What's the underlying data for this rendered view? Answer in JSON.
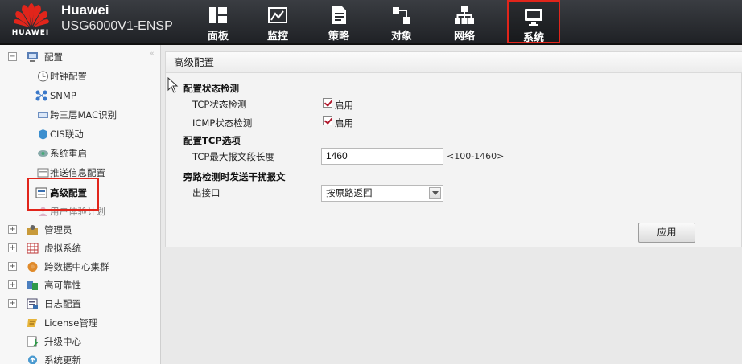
{
  "brand": {
    "logo_text": "HUAWEI",
    "vendor": "Huawei",
    "model": "USG6000V1-ENSP"
  },
  "nav": [
    {
      "label": "面板",
      "icon": "dashboard-icon"
    },
    {
      "label": "监控",
      "icon": "monitor-chart-icon"
    },
    {
      "label": "策略",
      "icon": "policy-document-icon"
    },
    {
      "label": "对象",
      "icon": "object-icon"
    },
    {
      "label": "网络",
      "icon": "network-topology-icon"
    },
    {
      "label": "系统",
      "icon": "system-monitor-icon",
      "active": true
    }
  ],
  "sidebar": {
    "root": {
      "label": "配置",
      "toggle": "−"
    },
    "children": [
      {
        "label": "时钟配置",
        "icon": "clock-icon"
      },
      {
        "label": "SNMP",
        "icon": "snmp-icon"
      },
      {
        "label": "跨三层MAC识别",
        "icon": "mac-icon"
      },
      {
        "label": "CIS联动",
        "icon": "cis-icon"
      },
      {
        "label": "系统重启",
        "icon": "restart-icon"
      },
      {
        "label": "推送信息配置",
        "icon": "push-icon"
      },
      {
        "label": "高级配置",
        "icon": "advanced-config-icon",
        "selected": true
      },
      {
        "label": "用户体验计划",
        "icon": "user-experience-icon"
      }
    ],
    "groups": [
      {
        "label": "管理员",
        "icon": "admin-icon",
        "toggle": "+"
      },
      {
        "label": "虚拟系统",
        "icon": "virtual-system-icon",
        "toggle": "+"
      },
      {
        "label": "跨数据中心集群",
        "icon": "cluster-icon",
        "toggle": "+"
      },
      {
        "label": "高可靠性",
        "icon": "high-availability-icon",
        "toggle": "+"
      },
      {
        "label": "日志配置",
        "icon": "log-config-icon",
        "toggle": "+"
      },
      {
        "label": "License管理",
        "icon": "license-icon"
      },
      {
        "label": "升级中心",
        "icon": "upgrade-icon"
      },
      {
        "label": "系统更新",
        "icon": "update-icon"
      }
    ]
  },
  "panel": {
    "title": "高级配置",
    "section_state": "配置状态检测",
    "tcp_state_label": "TCP状态检测",
    "tcp_state_value": "启用",
    "icmp_state_label": "ICMP状态检测",
    "icmp_state_value": "启用",
    "section_tcp": "配置TCP选项",
    "tcp_mss_label": "TCP最大报文段长度",
    "tcp_mss_value": "1460",
    "tcp_mss_hint": "<100-1460>",
    "section_bypass": "旁路检测时发送干扰报文",
    "egress_label": "出接口",
    "egress_value": "按原路返回",
    "apply_label": "应用"
  },
  "colors": {
    "highlight": "#e1251b",
    "topbar": "#2a2c30",
    "check": "#b0182c"
  }
}
